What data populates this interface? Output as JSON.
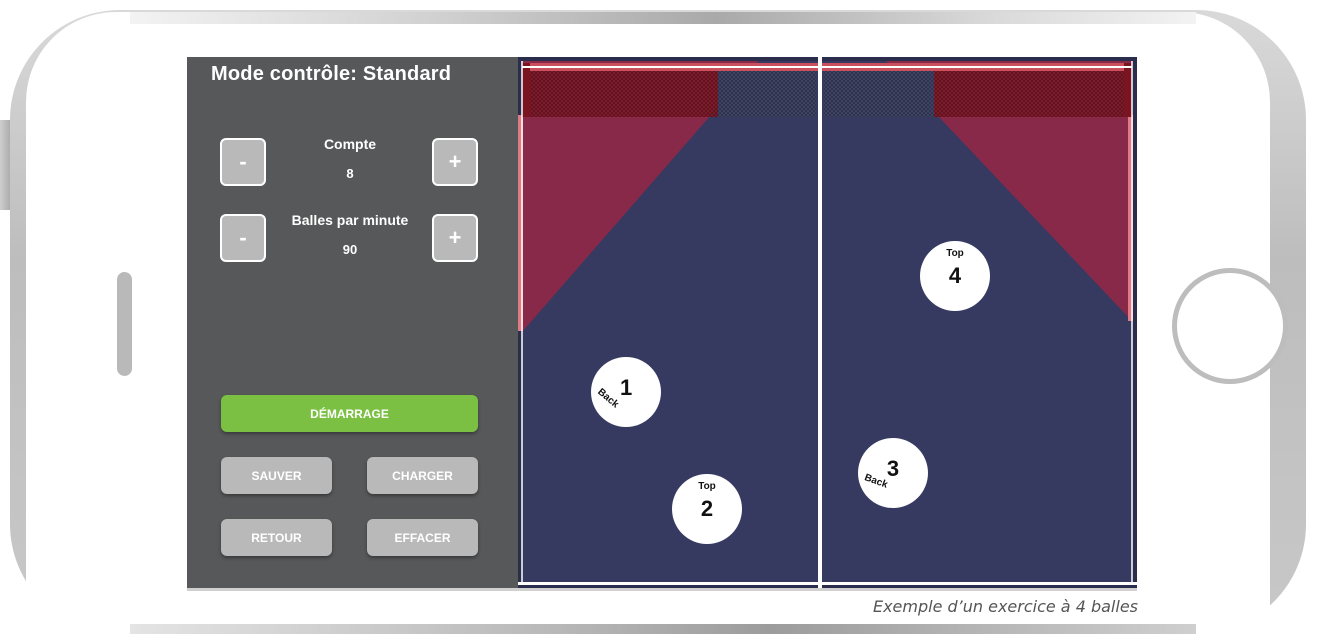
{
  "panel": {
    "mode_title": "Mode contrôle: Standard",
    "count": {
      "label": "Compte",
      "value": "8",
      "minus": "-",
      "plus": "+"
    },
    "bpm": {
      "label": "Balles par minute",
      "value": "90",
      "minus": "-",
      "plus": "+"
    },
    "buttons": {
      "start": "DÉMARRAGE",
      "save": "SAUVER",
      "load": "CHARGER",
      "back": "RETOUR",
      "clear": "EFFACER"
    }
  },
  "table": {
    "colors": {
      "surface": "#363a60",
      "zone": "#88294a",
      "net": "#7a1420",
      "line": "#ffffff",
      "button_grey": "#b9b9b9",
      "start_green": "#7bc043",
      "panel": "#575859"
    },
    "balls": [
      {
        "number": "1",
        "spin": "Back"
      },
      {
        "number": "2",
        "spin": "Top"
      },
      {
        "number": "3",
        "spin": "Back"
      },
      {
        "number": "4",
        "spin": "Top"
      }
    ]
  },
  "caption": "Exemple d’un exercice à 4 balles"
}
